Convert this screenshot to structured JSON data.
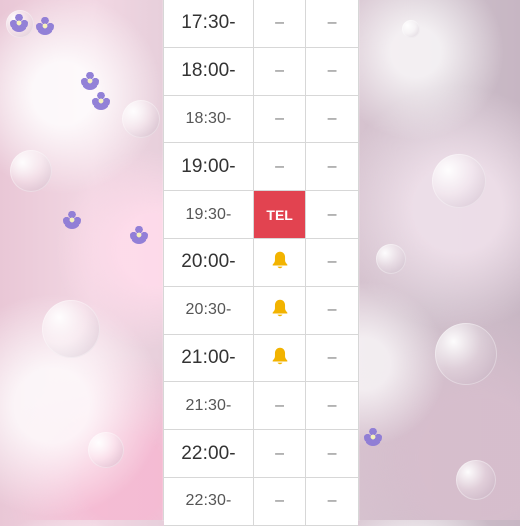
{
  "schedule": {
    "rows": [
      {
        "time": "17:30-",
        "slot1": "–",
        "slot2": "–",
        "status": "dash"
      },
      {
        "time": "18:00-",
        "slot1": "–",
        "slot2": "–",
        "status": "dash"
      },
      {
        "time": "18:30-",
        "slot1": "–",
        "slot2": "–",
        "status": "dash"
      },
      {
        "time": "19:00-",
        "slot1": "–",
        "slot2": "–",
        "status": "dash"
      },
      {
        "time": "19:30-",
        "slot1": "TEL",
        "slot2": "–",
        "status": "tel"
      },
      {
        "time": "20:00-",
        "slot1": "bell",
        "slot2": "–",
        "status": "bell"
      },
      {
        "time": "20:30-",
        "slot1": "bell",
        "slot2": "–",
        "status": "bell"
      },
      {
        "time": "21:00-",
        "slot1": "bell",
        "slot2": "–",
        "status": "bell"
      },
      {
        "time": "21:30-",
        "slot1": "–",
        "slot2": "–",
        "status": "dash"
      },
      {
        "time": "22:00-",
        "slot1": "–",
        "slot2": "–",
        "status": "dash"
      },
      {
        "time": "22:30-",
        "slot1": "–",
        "slot2": "–",
        "status": "dash"
      }
    ]
  },
  "colors": {
    "tel_bg": "#e24350",
    "bell": "#f2b300",
    "grid": "#d7d7d7"
  },
  "icons": {
    "bell": "bell-icon"
  }
}
